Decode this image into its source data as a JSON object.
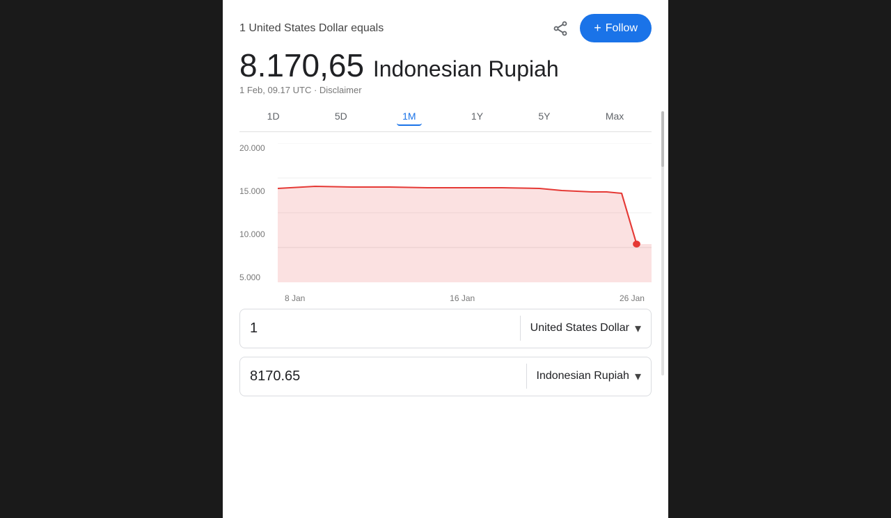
{
  "page": {
    "background": "#1a1a1a"
  },
  "header": {
    "title": "1 United States Dollar equals",
    "share_label": "share",
    "follow_label": "Follow"
  },
  "rate": {
    "value": "8.170,65",
    "currency": "Indonesian Rupiah",
    "timestamp": "1 Feb, 09.17 UTC · Disclaimer"
  },
  "tabs": [
    {
      "label": "1D",
      "active": false
    },
    {
      "label": "5D",
      "active": false
    },
    {
      "label": "1M",
      "active": true
    },
    {
      "label": "1Y",
      "active": false
    },
    {
      "label": "5Y",
      "active": false
    },
    {
      "label": "Max",
      "active": false
    }
  ],
  "chart": {
    "y_labels": [
      "20.000",
      "15.000",
      "10.000",
      "5.000"
    ],
    "x_labels": [
      "8 Jan",
      "16 Jan",
      "26 Jan"
    ],
    "line_color": "#e53935",
    "fill_color": "rgba(229,57,53,0.15)"
  },
  "converter": {
    "from": {
      "value": "1",
      "currency": "United States Dollar"
    },
    "to": {
      "value": "8170.65",
      "currency": "Indonesian Rupiah"
    }
  }
}
